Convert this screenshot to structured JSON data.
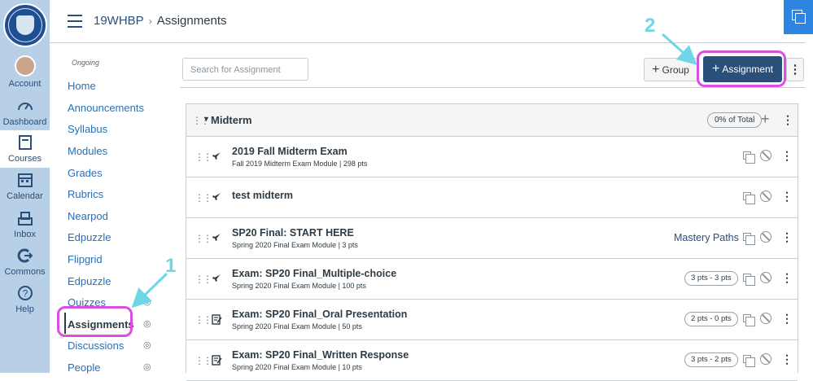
{
  "global_nav": {
    "items": [
      {
        "label": "Account",
        "icon": "avatar"
      },
      {
        "label": "Dashboard",
        "icon": "dashboard-icon"
      },
      {
        "label": "Courses",
        "icon": "courses-icon"
      },
      {
        "label": "Calendar",
        "icon": "calendar-icon"
      },
      {
        "label": "Inbox",
        "icon": "inbox-icon"
      },
      {
        "label": "Commons",
        "icon": "commons-icon"
      },
      {
        "label": "Help",
        "icon": "help-icon"
      }
    ]
  },
  "breadcrumb": {
    "course": "19WHBP",
    "separator": "›",
    "current": "Assignments"
  },
  "course_nav": {
    "term": "Ongoing",
    "items": [
      {
        "label": "Home"
      },
      {
        "label": "Announcements"
      },
      {
        "label": "Syllabus"
      },
      {
        "label": "Modules"
      },
      {
        "label": "Grades"
      },
      {
        "label": "Rubrics"
      },
      {
        "label": "Nearpod"
      },
      {
        "label": "Edpuzzle"
      },
      {
        "label": "Flipgrid"
      },
      {
        "label": "Edpuzzle"
      },
      {
        "label": "Quizzes"
      },
      {
        "label": "Assignments"
      },
      {
        "label": "Discussions"
      },
      {
        "label": "People"
      }
    ]
  },
  "toolbar": {
    "search_placeholder": "Search for Assignment",
    "group_label": "Group",
    "assignment_label": "Assignment"
  },
  "assignment_group": {
    "name": "Midterm",
    "weight": "0% of Total",
    "items": [
      {
        "title": "2019 Fall Midterm Exam",
        "meta": "Fall 2019 Midterm Exam Module  |  298 pts",
        "type": "quiz",
        "tag": ""
      },
      {
        "title": "test midterm",
        "meta": "",
        "type": "quiz",
        "tag": ""
      },
      {
        "title": "SP20 Final: START HERE",
        "meta": "Spring 2020 Final Exam Module  |  3 pts",
        "type": "quiz",
        "tag": "Mastery Paths"
      },
      {
        "title": "Exam: SP20 Final_Multiple-choice",
        "meta": "Spring 2020 Final Exam Module  |  100 pts",
        "type": "quiz",
        "tag": "3 pts - 3 pts"
      },
      {
        "title": "Exam: SP20 Final_Oral Presentation",
        "meta": "Spring 2020 Final Exam Module  |  50 pts",
        "type": "assignment",
        "tag": "2 pts - 0 pts"
      },
      {
        "title": "Exam: SP20 Final_Written Response",
        "meta": "Spring 2020 Final Exam Module  |  10 pts",
        "type": "assignment",
        "tag": "3 pts - 2 pts"
      }
    ]
  },
  "annotations": {
    "step1": "1",
    "step2": "2",
    "highlight_color": "#d94fe0",
    "arrow_color": "#6fd6e8"
  },
  "colors": {
    "nav_bg": "#b7d0e7",
    "brand": "#2a4f78",
    "link": "#2a6fb5"
  }
}
